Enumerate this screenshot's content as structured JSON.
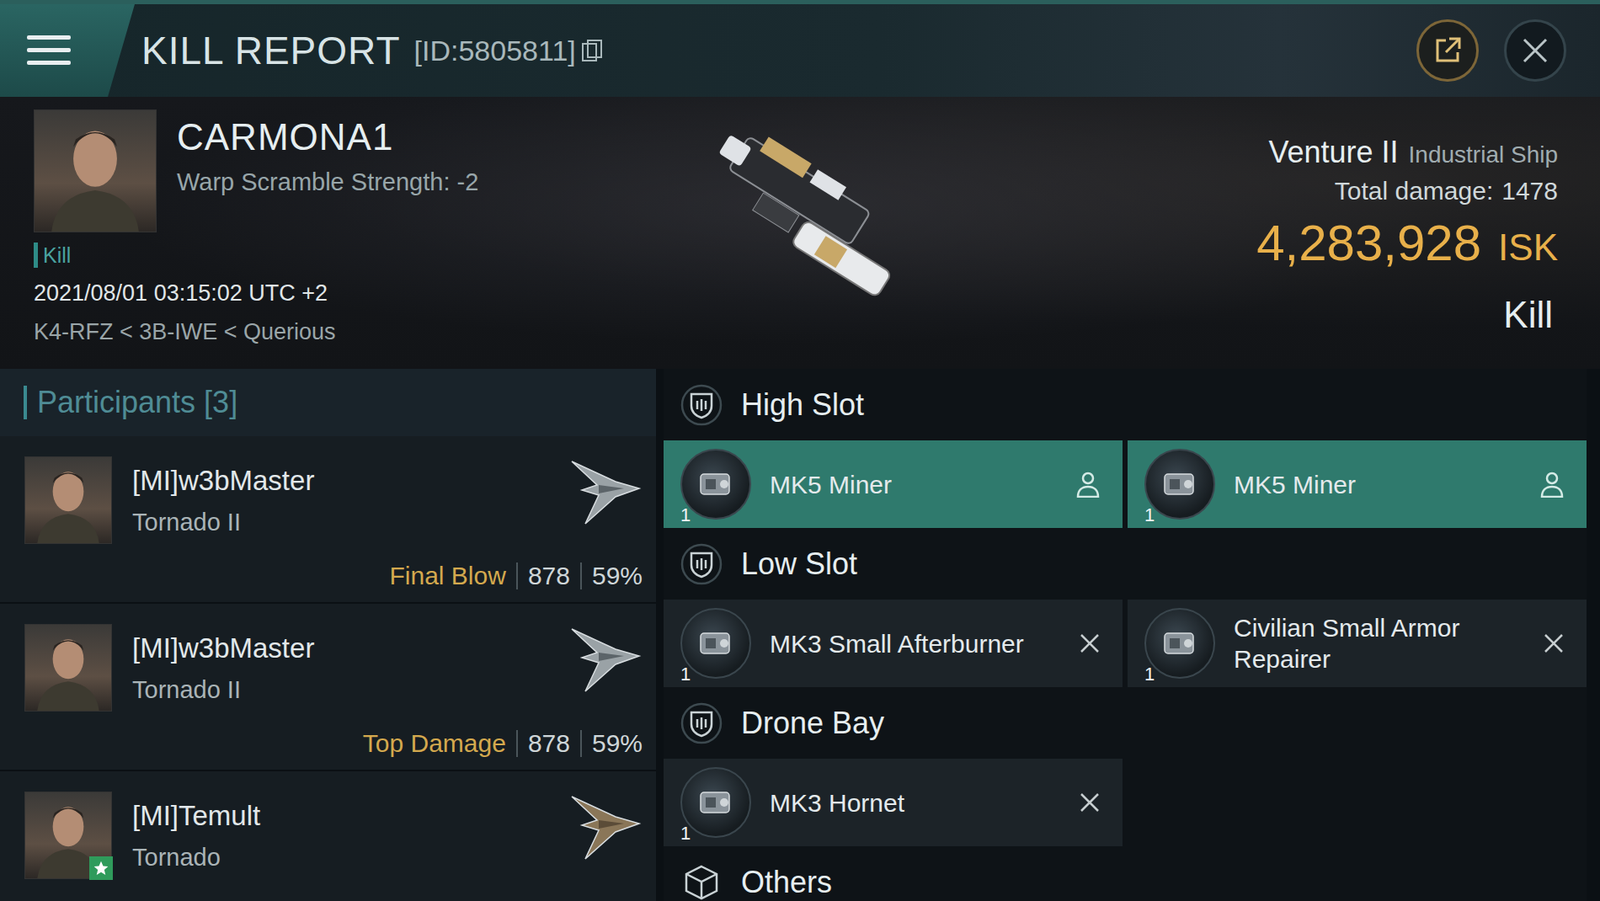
{
  "header": {
    "title": "KILL REPORT",
    "id": "[ID:5805811]"
  },
  "victim": {
    "name": "CARMONA1",
    "warp_scramble": "Warp Scramble Strength: -2",
    "tag": "Kill",
    "datetime": "2021/08/01 03:15:02 UTC +2",
    "location": "K4-RFZ < 3B-IWE < Querious"
  },
  "ship": {
    "name": "Venture II",
    "class": "Industrial Ship",
    "total_damage_label": "Total damage:",
    "total_damage": "1478",
    "value": "4,283,928",
    "currency": "ISK",
    "result": "Kill"
  },
  "participants": {
    "title": "Participants",
    "count": "[3]",
    "items": [
      {
        "name": "[MI]w3bMaster",
        "ship": "Tornado II",
        "badge": "Final Blow",
        "damage": "878",
        "share": "59%",
        "starred": false
      },
      {
        "name": "[MI]w3bMaster",
        "ship": "Tornado II",
        "badge": "Top Damage",
        "damage": "878",
        "share": "59%",
        "starred": false
      },
      {
        "name": "[MI]Temult",
        "ship": "Tornado",
        "starred": true
      }
    ]
  },
  "sections": [
    {
      "title": "High Slot",
      "kind": "slot",
      "items": [
        {
          "name": "MK5 Miner",
          "quantity": "1",
          "kind": "dropped"
        },
        {
          "name": "MK5 Miner",
          "quantity": "1",
          "kind": "dropped"
        }
      ]
    },
    {
      "title": "Low Slot",
      "kind": "slot",
      "items": [
        {
          "name": "MK3 Small Afterburner",
          "quantity": "1",
          "kind": "destroyed"
        },
        {
          "name": "Civilian Small Armor Repairer",
          "quantity": "1",
          "kind": "destroyed"
        }
      ]
    },
    {
      "title": "Drone Bay",
      "kind": "slot",
      "items": [
        {
          "name": "MK3  Hornet",
          "quantity": "1",
          "kind": "destroyed"
        }
      ]
    },
    {
      "title": "Others",
      "kind": "cargo",
      "items": []
    }
  ]
}
